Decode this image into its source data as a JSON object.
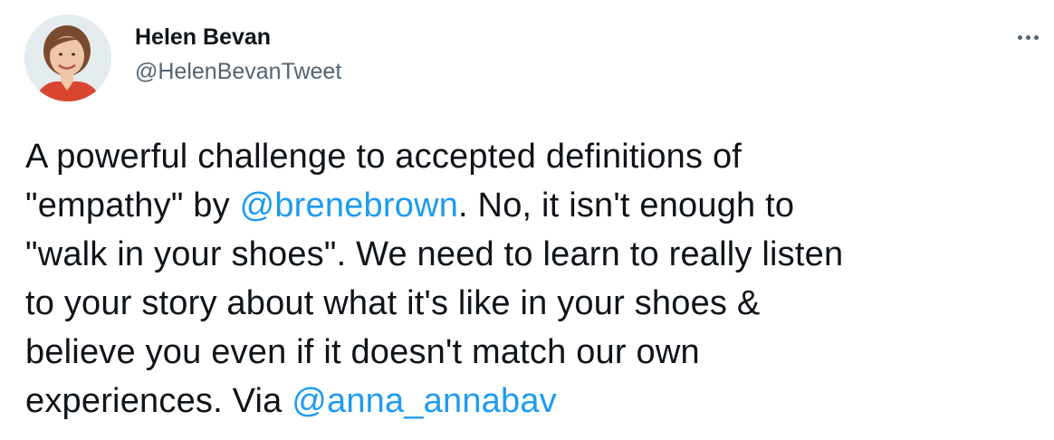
{
  "author": {
    "name": "Helen Bevan",
    "handle": "@HelenBevanTweet"
  },
  "more_icon": "ellipsis-icon",
  "tweet": {
    "line1": "A powerful challenge to accepted definitions of",
    "line2_pre": "\"empathy\" by ",
    "mention1": "@brenebrown",
    "line2_post": ". No, it isn't enough to",
    "line3": "\"walk in your shoes\". We need to learn to really listen",
    "line4": "to your story about what it's like in your shoes &",
    "line5": "believe you even if it doesn't match our own",
    "line6_pre": "experiences. Via ",
    "mention2": "@anna_annabav"
  },
  "colors": {
    "text": "#0f1419",
    "secondary": "#536471",
    "link": "#1d9bf0"
  }
}
